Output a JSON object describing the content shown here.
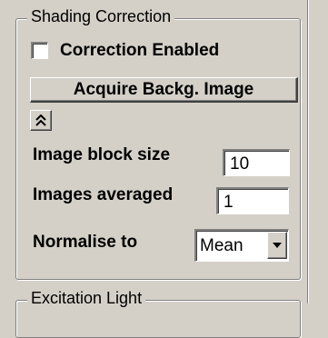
{
  "shading_group": {
    "title": "Shading Correction"
  },
  "correction_checkbox": {
    "label": "Correction Enabled",
    "checked": false
  },
  "acquire_button": {
    "label": "Acquire Backg. Image"
  },
  "collapse_button": {
    "icon": "double-chevron-up-icon"
  },
  "fields": {
    "block_size": {
      "label": "Image block size",
      "value": "10"
    },
    "images_averaged": {
      "label": "Images averaged",
      "value": "1"
    },
    "normalise": {
      "label": "Normalise to",
      "selected": "Mean"
    }
  },
  "excitation_group": {
    "title": "Excitation Light"
  },
  "colors": {
    "face": "#d4d0c8",
    "shadow": "#808080",
    "highlight": "#ffffff",
    "dark_shadow": "#404040"
  }
}
